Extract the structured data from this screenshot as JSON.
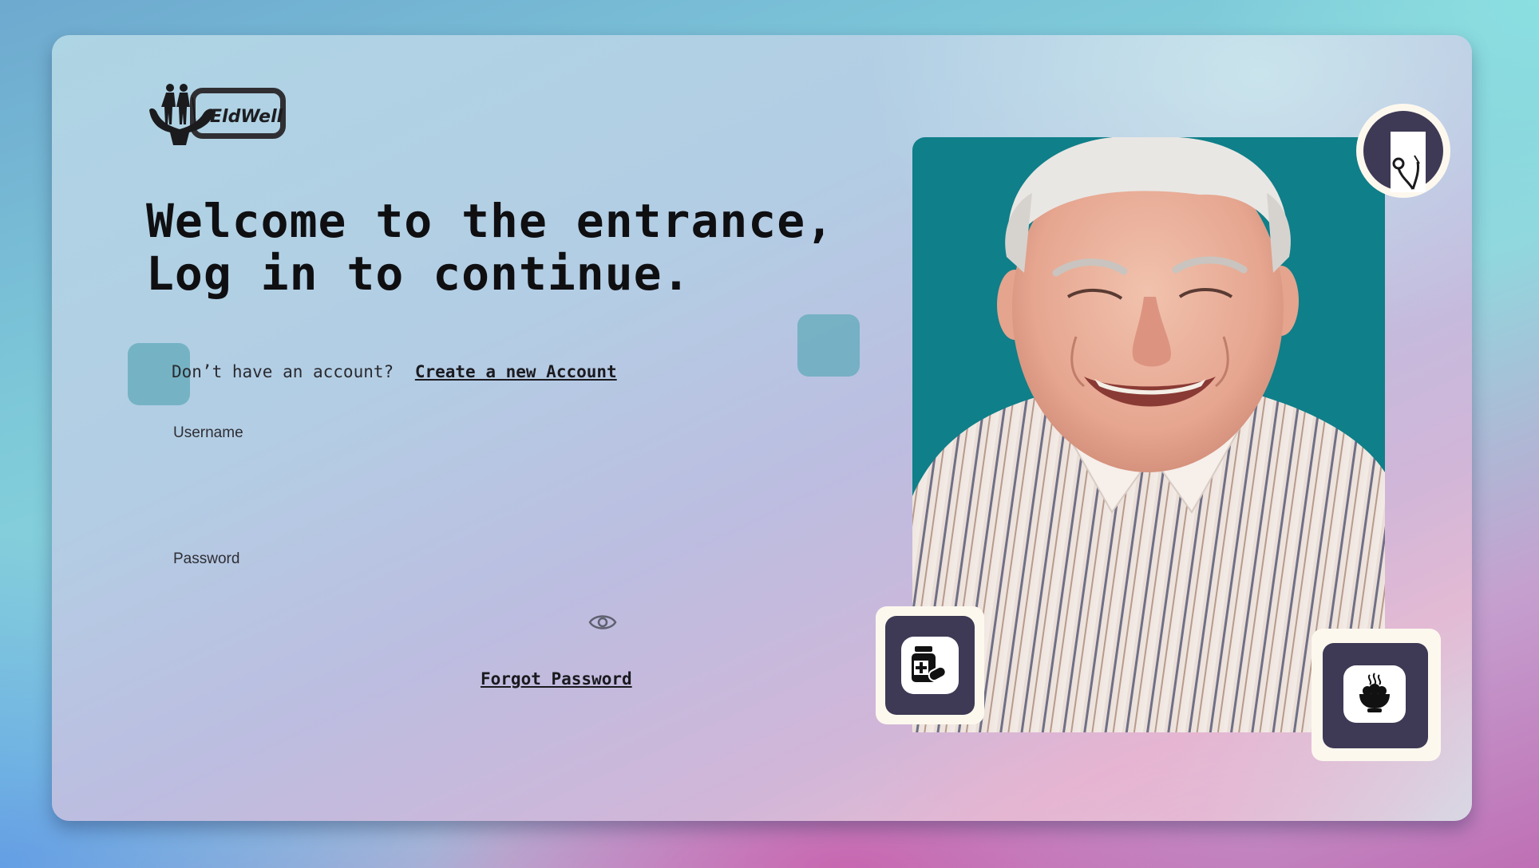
{
  "brand": {
    "name": "EldWell"
  },
  "headline": {
    "line1": "Welcome to the entrance,",
    "line2": "Log in to continue."
  },
  "signup": {
    "prompt": "Don’t have an account?",
    "link_label": "Create a new Account"
  },
  "form": {
    "username_label": "Username",
    "username_value": "",
    "password_label": "Password",
    "password_value": "",
    "forgot_label": "Forgot Password"
  },
  "icons": {
    "password_toggle": "eye-icon",
    "stethoscope_badge": "stethoscope-icon",
    "medicine_badge": "medicine-bottle-icon",
    "food_badge": "food-bowl-icon"
  },
  "colors": {
    "badge_dark": "#3e3a55",
    "badge_frame": "#fdf8ee",
    "photo_background": "#0f7f89",
    "text_dark": "#0f0f12",
    "deco_square": "#60aab9"
  }
}
